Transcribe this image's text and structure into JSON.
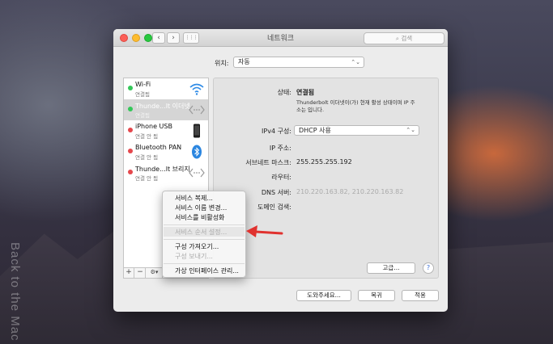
{
  "watermark": "Back to the Mac",
  "window": {
    "title": "네트워크",
    "search_placeholder": "검색",
    "nav_back": "‹",
    "nav_forward": "›",
    "grid": "⋮⋮⋮"
  },
  "location": {
    "label": "위치:",
    "value": "자동"
  },
  "services": [
    {
      "name": "Wi-Fi",
      "status": "연결됨",
      "dot": "#34c759",
      "icon": "wifi-icon"
    },
    {
      "name": "Thunde...lt 이더넷",
      "status": "연결됨",
      "dot": "#34c759",
      "icon": "ethernet-icon",
      "selected": true
    },
    {
      "name": "iPhone USB",
      "status": "연결 안 됨",
      "dot": "#e5484d",
      "icon": "iphone-icon"
    },
    {
      "name": "Bluetooth PAN",
      "status": "연결 안 됨",
      "dot": "#e5484d",
      "icon": "bluetooth-icon"
    },
    {
      "name": "Thunde...lt 브리지",
      "status": "연결 안 됨",
      "dot": "#e5484d",
      "icon": "bridge-icon"
    }
  ],
  "list_toolbar": {
    "add": "+",
    "remove": "−",
    "gear": "⚙▾"
  },
  "detail": {
    "status_label": "상태:",
    "status_value": "연결됨",
    "status_desc": "Thunderbolt 이더넷이(가) 현재 활성 상태이며 IP 주소는",
    "status_desc_tail": "입니다.",
    "ipv4_label": "IPv4 구성:",
    "ipv4_value": "DHCP 사용",
    "ip_label": "IP 주소:",
    "subnet_label": "서브네트 마스크:",
    "subnet_value": "255.255.255.192",
    "router_label": "라우터:",
    "dns_label": "DNS 서버:",
    "dns_value": "210.220.163.82, 210.220.163.82",
    "domain_label": "도메인 검색:",
    "advanced": "고급...",
    "help": "?"
  },
  "buttons": {
    "assist": "도와주세요...",
    "revert": "복귀",
    "apply": "적용"
  },
  "context_menu": {
    "items": [
      {
        "label": "서비스 복제...",
        "disabled": false
      },
      {
        "label": "서비스 이름 변경...",
        "disabled": false
      },
      {
        "label": "서비스를 비활성화",
        "disabled": false
      },
      {
        "label": "서비스 순서 설정...",
        "disabled": true
      },
      {
        "label": "구성 가져오기...",
        "disabled": false
      },
      {
        "label": "구성 보내기...",
        "disabled": true
      },
      {
        "label": "가상 인터페이스 관리...",
        "disabled": false
      }
    ]
  },
  "colors": {
    "accent_arrow": "#e0322f",
    "selected_bg": "#d5d5d5"
  }
}
